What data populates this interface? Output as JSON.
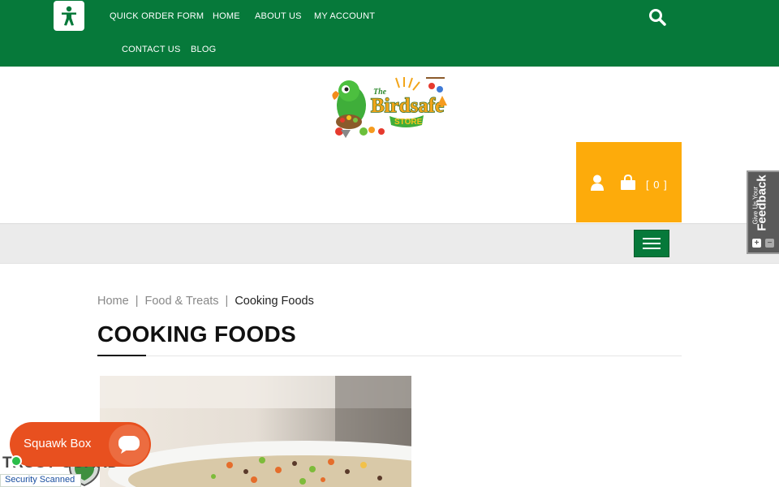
{
  "nav": {
    "links": [
      "QUICK ORDER FORM",
      "HOME",
      "ABOUT US",
      "MY ACCOUNT",
      "CONTACT US",
      "BLOG"
    ]
  },
  "logo": {
    "line1": "The",
    "line2": "Birdsafe",
    "line3": "STORE"
  },
  "cart": {
    "count": "[ 0 ]"
  },
  "feedback": {
    "small": "Give Us Your",
    "large": "Feedback",
    "plus": "+",
    "minus": "−"
  },
  "breadcrumb": {
    "items": [
      "Home",
      "Food & Treats",
      "Cooking Foods"
    ],
    "separator": "|"
  },
  "page": {
    "title": "COOKING FOODS"
  },
  "squawk": {
    "label": "Squawk Box"
  },
  "trust": {
    "brand": "TRUST GUARD",
    "sub": "Security Scanned"
  },
  "colors": {
    "primary": "#06793a",
    "cart": "#fdab0b",
    "squawk": "#e8501f"
  },
  "icons": [
    "accessibility-icon",
    "search-icon",
    "user-icon",
    "shopping-bag-icon",
    "hamburger-icon",
    "chat-bubble-icon",
    "shield-icon"
  ]
}
